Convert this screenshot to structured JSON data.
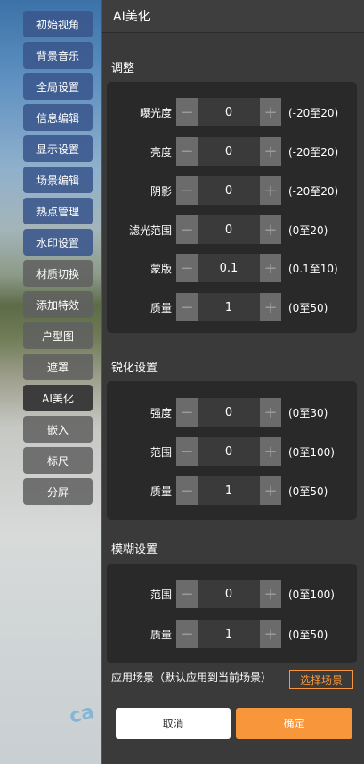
{
  "menu": {
    "items": [
      {
        "label": "初始视角",
        "style": "blue"
      },
      {
        "label": "背景音乐",
        "style": "blue"
      },
      {
        "label": "全局设置",
        "style": "blue"
      },
      {
        "label": "信息编辑",
        "style": "blue"
      },
      {
        "label": "显示设置",
        "style": "blue"
      },
      {
        "label": "场景编辑",
        "style": "blue"
      },
      {
        "label": "热点管理",
        "style": "blue"
      },
      {
        "label": "水印设置",
        "style": "blue"
      },
      {
        "label": "材质切换",
        "style": "gray"
      },
      {
        "label": "添加特效",
        "style": "gray"
      },
      {
        "label": "户型图",
        "style": "gray"
      },
      {
        "label": "遮罩",
        "style": "gray"
      },
      {
        "label": "AI美化",
        "style": "active"
      },
      {
        "label": "嵌入",
        "style": "gray"
      },
      {
        "label": "标尺",
        "style": "gray"
      },
      {
        "label": "分屏",
        "style": "gray"
      }
    ]
  },
  "panel": {
    "title": "AI美化",
    "adjust": {
      "title": "调整",
      "rows": [
        {
          "label": "曝光度",
          "value": "0",
          "range": "(-20至20)"
        },
        {
          "label": "亮度",
          "value": "0",
          "range": "(-20至20)"
        },
        {
          "label": "阴影",
          "value": "0",
          "range": "(-20至20)"
        },
        {
          "label": "滤光范围",
          "value": "0",
          "range": "(0至20)"
        },
        {
          "label": "蒙版",
          "value": "0.1",
          "range": "(0.1至10)"
        },
        {
          "label": "质量",
          "value": "1",
          "range": "(0至50)"
        }
      ]
    },
    "sharpen": {
      "title": "锐化设置",
      "rows": [
        {
          "label": "强度",
          "value": "0",
          "range": "(0至30)"
        },
        {
          "label": "范围",
          "value": "0",
          "range": "(0至100)"
        },
        {
          "label": "质量",
          "value": "1",
          "range": "(0至50)"
        }
      ]
    },
    "blur": {
      "title": "模糊设置",
      "rows": [
        {
          "label": "范围",
          "value": "0",
          "range": "(0至100)"
        },
        {
          "label": "质量",
          "value": "1",
          "range": "(0至50)"
        }
      ]
    },
    "stepper": {
      "minus": "−",
      "plus": "+"
    },
    "apply_label": "应用场景（默认应用到当前场景）",
    "choose_label": "选择场景",
    "cancel_label": "取消",
    "ok_label": "确定"
  },
  "colors": {
    "accent": "#f7963a",
    "menu_blue": "#3a568c",
    "panel_bg": "#3b3a3a",
    "box_bg": "#2a2929"
  }
}
